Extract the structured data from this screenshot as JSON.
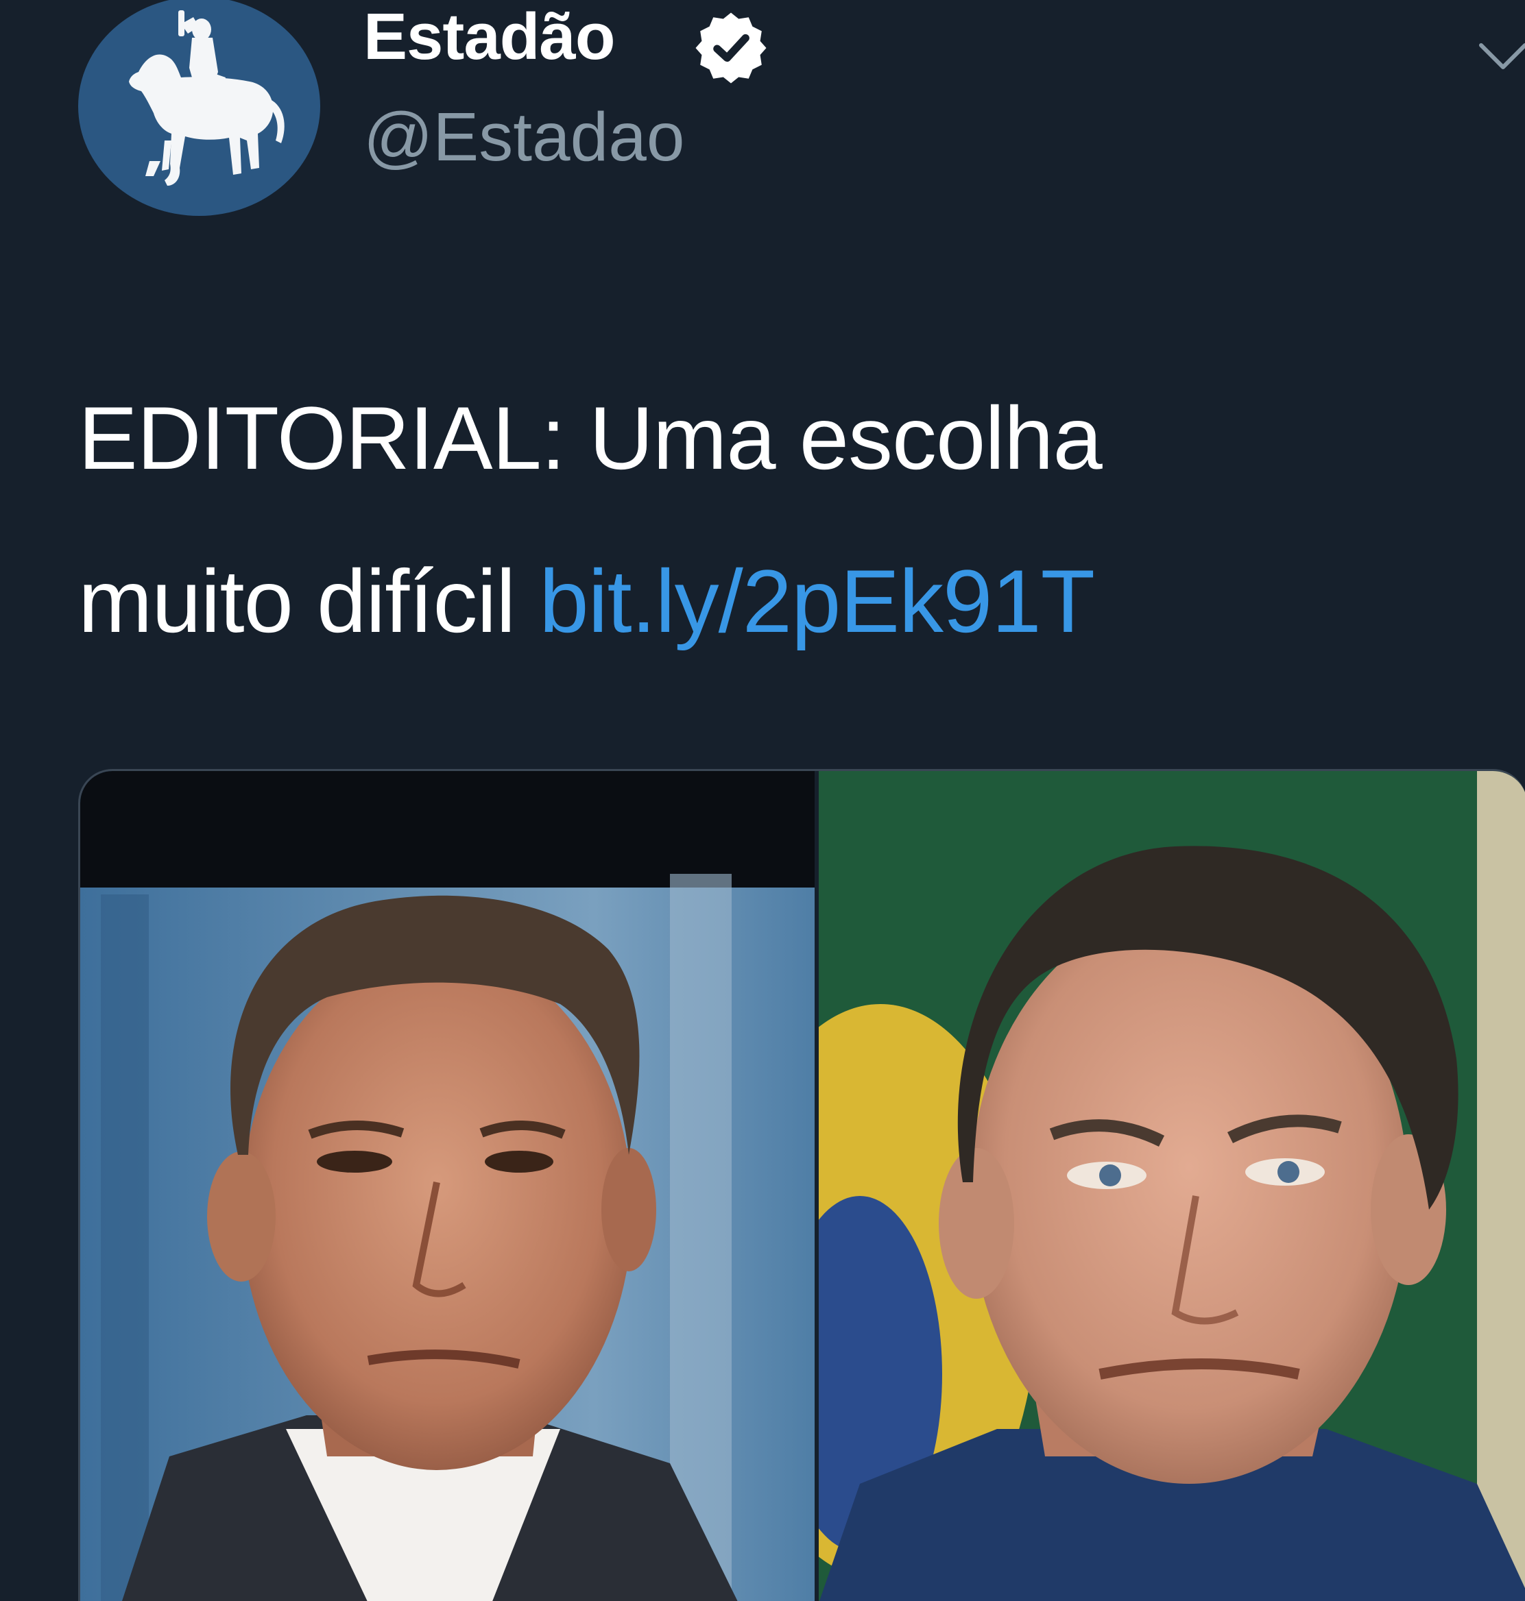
{
  "tweet": {
    "author": {
      "display_name": "Estadão",
      "handle": "@Estadao",
      "avatar_icon": "horse-rider-logo-icon",
      "verified_icon": "verified-badge-icon"
    },
    "menu_icon": "chevron-down-icon",
    "text_line1": "EDITORIAL: Uma escolha",
    "text_line2_prefix": "muito difícil",
    "link": "bit.ly/2pEk91T",
    "media": {
      "photos": [
        "portrait-photo-left",
        "portrait-photo-right"
      ]
    }
  },
  "colors": {
    "background": "#16202c",
    "text": "#ffffff",
    "handle": "#8899a6",
    "link": "#3897e6",
    "avatar": "#2b5782"
  }
}
